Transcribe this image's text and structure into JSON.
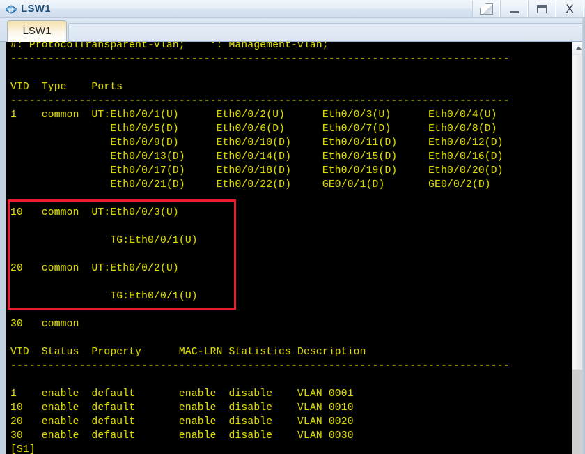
{
  "window": {
    "title": "LSW1",
    "icon": "switch-icon",
    "controls": [
      {
        "name": "restore-button",
        "glyph": "detach"
      },
      {
        "name": "minimize-button",
        "glyph": "minimize"
      },
      {
        "name": "maximize-button",
        "glyph": "maximize"
      },
      {
        "name": "close-button",
        "glyph": "X",
        "label": "X"
      }
    ]
  },
  "tabs": {
    "active": "LSW1",
    "items": [
      {
        "label": "LSW1",
        "selected": true
      }
    ]
  },
  "terminal": {
    "foreground": "#d8d800",
    "background": "#000000",
    "prompt": "[S1]",
    "legend_line": "#: ProtocolTransparent-vlan;    *: Management-vlan;",
    "separator": "--------------------------------------------------------------------------------",
    "ports_table": {
      "headers": [
        "VID",
        "Type",
        "Ports"
      ],
      "rows": [
        {
          "vid": "1",
          "type": "common",
          "port_lines": [
            "UT:Eth0/0/1(U)      Eth0/0/2(U)      Eth0/0/3(U)      Eth0/0/4(U)",
            "   Eth0/0/5(D)      Eth0/0/6(D)      Eth0/0/7(D)      Eth0/0/8(D)",
            "   Eth0/0/9(D)      Eth0/0/10(D)     Eth0/0/11(D)     Eth0/0/12(D)",
            "   Eth0/0/13(D)     Eth0/0/14(D)     Eth0/0/15(D)     Eth0/0/16(D)",
            "   Eth0/0/17(D)     Eth0/0/18(D)     Eth0/0/19(D)     Eth0/0/20(D)",
            "   Eth0/0/21(D)     Eth0/0/22(D)     GE0/0/1(D)       GE0/0/2(D)"
          ]
        },
        {
          "vid": "10",
          "type": "common",
          "port_lines": [
            "UT:Eth0/0/3(U)",
            "",
            "TG:Eth0/0/1(U)"
          ]
        },
        {
          "vid": "20",
          "type": "common",
          "port_lines": [
            "UT:Eth0/0/2(U)",
            "",
            "TG:Eth0/0/1(U)"
          ]
        },
        {
          "vid": "30",
          "type": "common",
          "port_lines": [
            ""
          ]
        }
      ]
    },
    "status_table": {
      "headers": [
        "VID",
        "Status",
        "Property",
        "MAC-LRN",
        "Statistics",
        "Description"
      ],
      "rows": [
        [
          "1",
          "enable",
          "default",
          "enable",
          "disable",
          "VLAN 0001"
        ],
        [
          "10",
          "enable",
          "default",
          "enable",
          "disable",
          "VLAN 0010"
        ],
        [
          "20",
          "enable",
          "default",
          "enable",
          "disable",
          "VLAN 0020"
        ],
        [
          "30",
          "enable",
          "default",
          "enable",
          "disable",
          "VLAN 0030"
        ]
      ]
    },
    "full_text": "#: ProtocolTransparent-vlan;    *: Management-vlan;\n--------------------------------------------------------------------------------\n\nVID  Type    Ports\n--------------------------------------------------------------------------------\n1    common  UT:Eth0/0/1(U)      Eth0/0/2(U)      Eth0/0/3(U)      Eth0/0/4(U)\n                Eth0/0/5(D)      Eth0/0/6(D)      Eth0/0/7(D)      Eth0/0/8(D)\n                Eth0/0/9(D)      Eth0/0/10(D)     Eth0/0/11(D)     Eth0/0/12(D)\n                Eth0/0/13(D)     Eth0/0/14(D)     Eth0/0/15(D)     Eth0/0/16(D)\n                Eth0/0/17(D)     Eth0/0/18(D)     Eth0/0/19(D)     Eth0/0/20(D)\n                Eth0/0/21(D)     Eth0/0/22(D)     GE0/0/1(D)       GE0/0/2(D)\n\n10   common  UT:Eth0/0/3(U)\n\n                TG:Eth0/0/1(U)\n\n20   common  UT:Eth0/0/2(U)\n\n                TG:Eth0/0/1(U)\n\n30   common\n\nVID  Status  Property      MAC-LRN Statistics Description\n--------------------------------------------------------------------------------\n\n1    enable  default       enable  disable    VLAN 0001\n10   enable  default       enable  disable    VLAN 0010\n20   enable  default       enable  disable    VLAN 0020\n30   enable  default       enable  disable    VLAN 0030\n[S1]"
  },
  "annotation": {
    "name": "red-highlight-box",
    "color": "#ee1b2e",
    "covers": "VLAN 10 and VLAN 20 port assignment rows"
  },
  "scrollbar": {
    "up_arrow": "chevron-up-icon",
    "orientation": "vertical"
  }
}
